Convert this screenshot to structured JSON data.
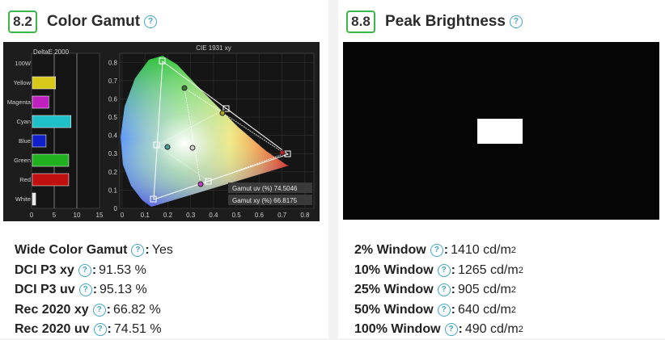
{
  "left": {
    "score": "8.2",
    "title": "Color Gamut",
    "deltae": {
      "header": "DeltaE 2000",
      "x_ticks": [
        "0",
        "5",
        "10",
        "15"
      ],
      "rows": [
        {
          "label": "100W",
          "value": 0,
          "color": "#ffffff"
        },
        {
          "label": "Yellow",
          "value": 5.3,
          "color": "#d8c81a"
        },
        {
          "label": "Magenta",
          "value": 3.8,
          "color": "#c020c0"
        },
        {
          "label": "Cyan",
          "value": 8.7,
          "color": "#20c0c8"
        },
        {
          "label": "Blue",
          "value": 3.2,
          "color": "#1020c8"
        },
        {
          "label": "Green",
          "value": 8.2,
          "color": "#20b020"
        },
        {
          "label": "Red",
          "value": 8.2,
          "color": "#c01010"
        },
        {
          "label": "White",
          "value": 0.9,
          "color": "#e8e8e8"
        }
      ]
    },
    "cie": {
      "title": "CIE 1931 xy",
      "x_ticks": [
        "0",
        "0.1",
        "0.2",
        "0.3",
        "0.4",
        "0.5",
        "0.6",
        "0.7",
        "0.8"
      ],
      "y_ticks": [
        "0",
        "0.1",
        "0.2",
        "0.3",
        "0.4",
        "0.5",
        "0.6",
        "0.7",
        "0.8"
      ],
      "legend_uv": "Gamut uv (%) 74.5046",
      "legend_xy": "Gamut xy (%) 66.8175"
    },
    "stats": [
      {
        "label": "Wide Color Gamut",
        "value": "Yes"
      },
      {
        "label": "DCI P3 xy",
        "value": "91.53 %"
      },
      {
        "label": "DCI P3 uv",
        "value": "95.13 %"
      },
      {
        "label": "Rec 2020 xy",
        "value": "66.82 %"
      },
      {
        "label": "Rec 2020 uv",
        "value": "74.51 %"
      }
    ]
  },
  "right": {
    "score": "8.8",
    "title": "Peak Brightness",
    "stats": [
      {
        "label": "2% Window",
        "value": "1410 cd/m",
        "sup": "2"
      },
      {
        "label": "10% Window",
        "value": "1265 cd/m",
        "sup": "2"
      },
      {
        "label": "25% Window",
        "value": "905 cd/m",
        "sup": "2"
      },
      {
        "label": "50% Window",
        "value": "640 cd/m",
        "sup": "2"
      },
      {
        "label": "100% Window",
        "value": "490 cd/m",
        "sup": "2"
      }
    ]
  },
  "colors": {
    "score_border": "#3cb64a",
    "help_icon": "#40a6c8"
  }
}
